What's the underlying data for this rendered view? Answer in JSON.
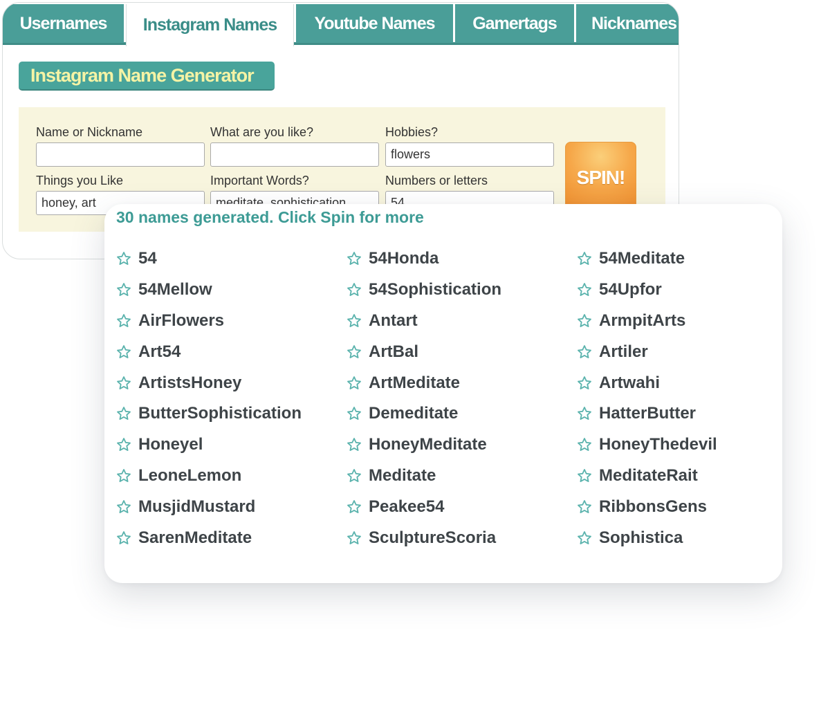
{
  "tabs": [
    {
      "label": "Usernames",
      "active": false
    },
    {
      "label": "Instagram Names",
      "active": true
    },
    {
      "label": "Youtube Names",
      "active": false
    },
    {
      "label": "Gamertags",
      "active": false
    },
    {
      "label": "Nicknames",
      "active": false
    }
  ],
  "generator": {
    "title": "Instagram Name Generator",
    "fields": [
      {
        "label": "Name or Nickname",
        "value": ""
      },
      {
        "label": "What are you like?",
        "value": ""
      },
      {
        "label": "Hobbies?",
        "value": "flowers"
      },
      {
        "label": "Things you Like",
        "value": "honey, art"
      },
      {
        "label": "Important Words?",
        "value": "meditate, sophistication"
      },
      {
        "label": "Numbers or letters",
        "value": "54"
      }
    ],
    "spin_label": "SPIN!"
  },
  "results": {
    "header": "30 names generated. Click Spin for more",
    "star_icon": "star-outline-icon",
    "names": [
      "54",
      "54Honda",
      "54Meditate",
      "54Mellow",
      "54Sophistication",
      "54Upfor",
      "AirFlowers",
      "Antart",
      "ArmpitArts",
      "Art54",
      "ArtBal",
      "Artiler",
      "ArtistsHoney",
      "ArtMeditate",
      "Artwahi",
      "ButterSophistication",
      "Demeditate",
      "HatterButter",
      "Honeyel",
      "HoneyMeditate",
      "HoneyThedevil",
      "LeoneLemon",
      "Meditate",
      "MeditateRait",
      "MusjidMustard",
      "Peakee54",
      "RibbonsGens",
      "SarenMeditate",
      "SculptureScoria",
      "Sophistica"
    ]
  },
  "colors": {
    "teal": "#4a9e98",
    "title_text": "#f5f3a5",
    "panel_bg": "#f8f5de",
    "spin_orange": "#f6a84a",
    "header_teal": "#3d9b95",
    "star": "#5bb3ad"
  }
}
